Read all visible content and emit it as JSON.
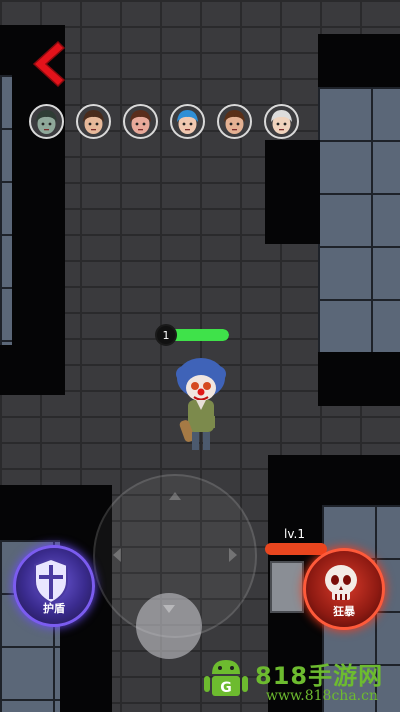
{
  "hud": {
    "player_level": "1",
    "player_hp_fraction": 1.0,
    "enemy_level": "lv.1",
    "enemy_hp_fraction": 1.0
  },
  "skills": {
    "shield_label": "护盾",
    "rage_label": "狂暴"
  },
  "survivors": [
    {
      "name": "survivor-1",
      "hair": "#2f3d35",
      "skin": "#8fa89a"
    },
    {
      "name": "survivor-2",
      "hair": "#4a2c1c",
      "skin": "#e7b99a"
    },
    {
      "name": "survivor-3",
      "hair": "#5a2d1c",
      "skin": "#e8a99a"
    },
    {
      "name": "survivor-4",
      "hair": "#2f8fd6",
      "skin": "#f0c8b0"
    },
    {
      "name": "survivor-5",
      "hair": "#5a3018",
      "skin": "#e4b193"
    },
    {
      "name": "survivor-6",
      "hair": "#dcdcdc",
      "skin": "#f0d3bd"
    }
  ],
  "watermark": {
    "site_name": "818手游网",
    "url": "www.818cha.cn",
    "badge_letter": "G"
  },
  "colors": {
    "back_arrow": "#e3131b",
    "hp_green": "#3fe24a",
    "enemy_red": "#e8461f",
    "shield_purple": "#7b5cf0",
    "rage_red": "#ff5a3a",
    "watermark_green": "#6dbb2f"
  }
}
